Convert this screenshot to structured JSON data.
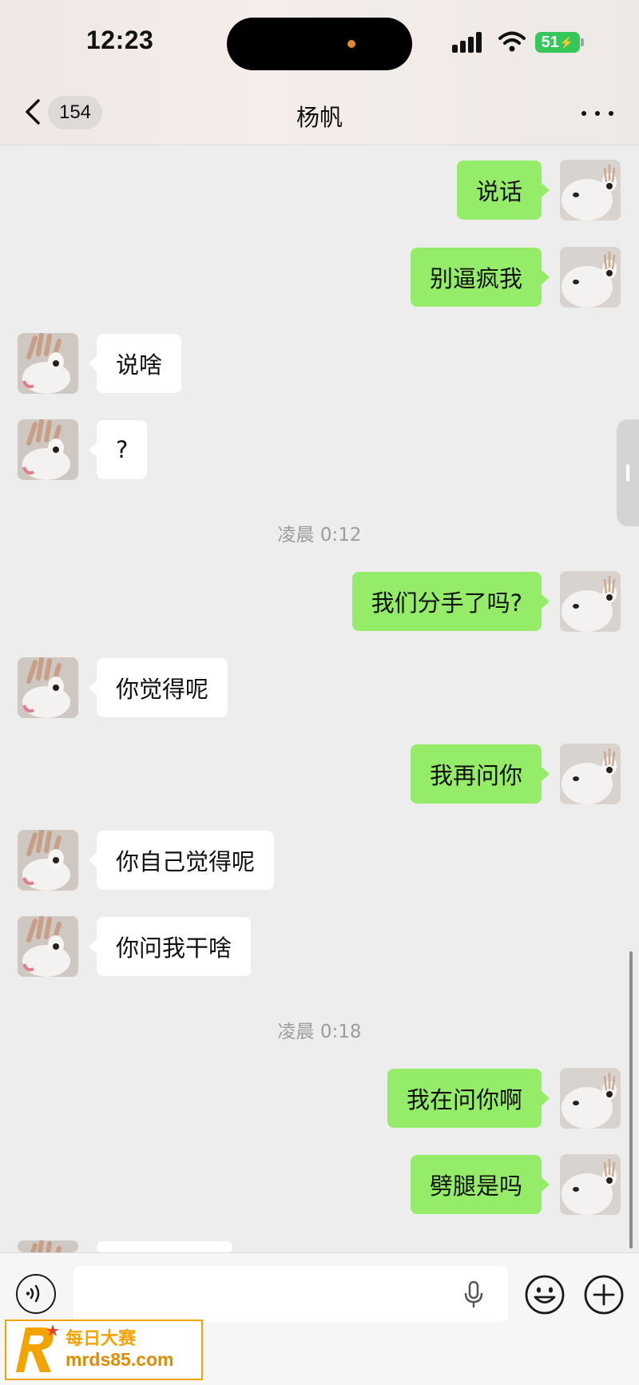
{
  "status_bar": {
    "time": "12:23",
    "battery": "51"
  },
  "header": {
    "back_count": "154",
    "title": "杨帆"
  },
  "messages": [
    {
      "side": "right",
      "text": "说话"
    },
    {
      "side": "right",
      "text": "别逼疯我"
    },
    {
      "side": "left",
      "text": "说啥"
    },
    {
      "side": "left",
      "text": "?"
    },
    {
      "type": "timestamp",
      "text": "凌晨 0:12"
    },
    {
      "side": "right",
      "text": "我们分手了吗?"
    },
    {
      "side": "left",
      "text": "你觉得呢"
    },
    {
      "side": "right",
      "text": "我再问你"
    },
    {
      "side": "left",
      "text": "你自己觉得呢"
    },
    {
      "side": "left",
      "text": "你问我干啥"
    },
    {
      "type": "timestamp",
      "text": "凌晨 0:18"
    },
    {
      "side": "right",
      "text": "我在问你啊"
    },
    {
      "side": "right",
      "text": "劈腿是吗"
    }
  ],
  "input": {
    "value": "",
    "placeholder": ""
  },
  "watermark": {
    "title": "每日大赛",
    "url": "mrds85.com"
  },
  "colors": {
    "sent_bubble": "#95ec69",
    "received_bubble": "#ffffff",
    "background": "#ededed"
  },
  "icons": [
    "back-chevron-icon",
    "more-icon",
    "voice-icon",
    "microphone-icon",
    "emoji-icon",
    "plus-icon"
  ]
}
